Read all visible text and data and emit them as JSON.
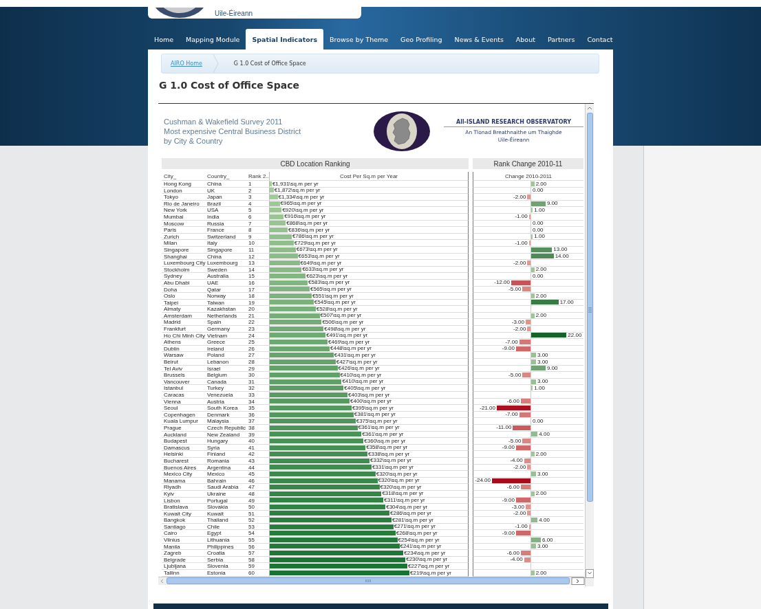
{
  "site": {
    "logo_text": "Uile-Éireann"
  },
  "nav": [
    {
      "label": "Home",
      "selected": false
    },
    {
      "label": "Mapping Module",
      "selected": false
    },
    {
      "label": "Spatial Indicators",
      "selected": true
    },
    {
      "label": "Browse by Theme",
      "selected": false
    },
    {
      "label": "Geo Profiling",
      "selected": false
    },
    {
      "label": "News & Events",
      "selected": false
    },
    {
      "label": "About",
      "selected": false
    },
    {
      "label": "Partners",
      "selected": false
    },
    {
      "label": "Contact",
      "selected": false
    }
  ],
  "breadcrumb": [
    {
      "label": "AIRO Home",
      "kind": "link"
    },
    {
      "label": "G 1.0 Cost of Office Space",
      "kind": "current"
    }
  ],
  "page_title": "G 1.0 Cost of Office Space",
  "report": {
    "title_lines": [
      "Cushman & Wakefield Survey 2011",
      "Most expensive Central Business District",
      "by City & Country"
    ],
    "logo_lines": [
      "All-ISLAND RESEARCH OBSERVATORY",
      "An Tlonad Breathnaithe um Thaighde",
      "Uile-Éireann"
    ],
    "panel_titles": [
      "CBD Location Ranking",
      "Rank Change 2010-11"
    ],
    "columns": [
      "City_",
      "Country_",
      "Rank 2..",
      "Cost Per Sq.m per Year",
      "Change 2010-2011"
    ],
    "rows": [
      {
        "city": "Hong Kong",
        "country": "China",
        "rank": "1",
        "cost": "€1,931\\sq.m per yr",
        "level": 0.01,
        "change": {
          "text": "2.00",
          "kind": "up"
        }
      },
      {
        "city": "London",
        "country": "UK",
        "rank": "2",
        "cost": "€1,872\\sq.m per yr",
        "level": 0.02,
        "change": {
          "text": "0.00",
          "kind": "none"
        }
      },
      {
        "city": "Tokyo",
        "country": "Japan",
        "rank": "3",
        "cost": "€1,334\\sq.m per yr",
        "level": 0.04,
        "change": {
          "text": "-2.00",
          "kind": "down"
        }
      },
      {
        "city": "Rio de Janeiro",
        "country": "Brazil",
        "rank": "4",
        "cost": "€965\\sq.m per yr",
        "level": 0.05,
        "change": {
          "text": "9.00",
          "kind": "up"
        }
      },
      {
        "city": "New York",
        "country": "USA",
        "rank": "5",
        "cost": "€920\\sq.m per yr",
        "level": 0.06,
        "change": {
          "text": "1.00",
          "kind": "up"
        }
      },
      {
        "city": "Mumbai",
        "country": "India",
        "rank": "6",
        "cost": "€916\\sq.m per yr",
        "level": 0.07,
        "change": {
          "text": "-1.00",
          "kind": "down"
        }
      },
      {
        "city": "Moscow",
        "country": "Russia",
        "rank": "7",
        "cost": "€868\\sq.m per yr",
        "level": 0.08,
        "change": {
          "text": "0.00",
          "kind": "none"
        }
      },
      {
        "city": "Paris",
        "country": "France",
        "rank": "8",
        "cost": "€836\\sq.m per yr",
        "level": 0.09,
        "change": {
          "text": "0.00",
          "kind": "none"
        }
      },
      {
        "city": "Zurich",
        "country": "Switzerland",
        "rank": "9",
        "cost": "€786\\sq.m per yr",
        "level": 0.11,
        "change": {
          "text": "1.00",
          "kind": "up"
        }
      },
      {
        "city": "Milan",
        "country": "Italy",
        "rank": "10",
        "cost": "€729\\sq.m per yr",
        "level": 0.12,
        "change": {
          "text": "-1.00",
          "kind": "down"
        }
      },
      {
        "city": "Singapore",
        "country": "Singapore",
        "rank": "11",
        "cost": "€673\\sq.m per yr",
        "level": 0.13,
        "change": {
          "text": "13.00",
          "kind": "up"
        }
      },
      {
        "city": "Shanghai",
        "country": "China",
        "rank": "12",
        "cost": "€653\\sq.m per yr",
        "level": 0.14,
        "change": {
          "text": "14.00",
          "kind": "up"
        }
      },
      {
        "city": "Luxembourg City",
        "country": "Luxembourg",
        "rank": "13",
        "cost": "€649\\sq.m per yr",
        "level": 0.15,
        "change": {
          "text": "-2.00",
          "kind": "down"
        }
      },
      {
        "city": "Stockholm",
        "country": "Sweden",
        "rank": "14",
        "cost": "€633\\sq.m per yr",
        "level": 0.16,
        "change": {
          "text": "2.00",
          "kind": "up"
        }
      },
      {
        "city": "Sydney",
        "country": "Australia",
        "rank": "15",
        "cost": "€623\\sq.m per yr",
        "level": 0.18,
        "change": {
          "text": "0.00",
          "kind": "none"
        }
      },
      {
        "city": "Abu Dhabi",
        "country": "UAE",
        "rank": "16",
        "cost": "€583\\sq.m per yr",
        "level": 0.19,
        "change": {
          "text": "-12.00",
          "kind": "down"
        }
      },
      {
        "city": "Doha",
        "country": "Qatar",
        "rank": "17",
        "cost": "€565\\sq.m per yr",
        "level": 0.2,
        "change": {
          "text": "-5.00",
          "kind": "down"
        }
      },
      {
        "city": "Oslo",
        "country": "Norway",
        "rank": "18",
        "cost": "€551\\sq.m per yr",
        "level": 0.21,
        "change": {
          "text": "2.00",
          "kind": "up"
        }
      },
      {
        "city": "Taipei",
        "country": "Taiwan",
        "rank": "19",
        "cost": "€545\\sq.m per yr",
        "level": 0.22,
        "change": {
          "text": "17.00",
          "kind": "up"
        }
      },
      {
        "city": "Almaty",
        "country": "Kazakhstan",
        "rank": "20",
        "cost": "€528\\sq.m per yr",
        "level": 0.23
      },
      {
        "city": "Amsterdam",
        "country": "Netherlands",
        "rank": "21",
        "cost": "€507\\sq.m per yr",
        "level": 0.25,
        "change": {
          "text": "2.00",
          "kind": "up"
        }
      },
      {
        "city": "Madrid",
        "country": "Spain",
        "rank": "22",
        "cost": "€506\\sq.m per yr",
        "level": 0.26,
        "change": {
          "text": "-3.00",
          "kind": "down"
        }
      },
      {
        "city": "Frankfurt",
        "country": "Germany",
        "rank": "23",
        "cost": "€498\\sq.m per yr",
        "level": 0.27,
        "change": {
          "text": "-2.00",
          "kind": "down"
        }
      },
      {
        "city": "Ho Chi Minh City",
        "country": "Vietnam",
        "rank": "24",
        "cost": "€491\\sq.m per yr",
        "level": 0.28,
        "change": {
          "text": "22.00",
          "kind": "up"
        }
      },
      {
        "city": "Athens",
        "country": "Greece",
        "rank": "25",
        "cost": "€469\\sq.m per yr",
        "level": 0.29,
        "change": {
          "text": "-7.00",
          "kind": "down"
        }
      },
      {
        "city": "Dublin",
        "country": "Ireland",
        "rank": "26",
        "cost": "€448\\sq.m per yr",
        "level": 0.3,
        "change": {
          "text": "-9.00",
          "kind": "down"
        }
      },
      {
        "city": "Warsaw",
        "country": "Poland",
        "rank": "27",
        "cost": "€431\\sq.m per yr",
        "level": 0.32,
        "change": {
          "text": "3.00",
          "kind": "up"
        }
      },
      {
        "city": "Beirut",
        "country": "Lebanon",
        "rank": "28",
        "cost": "€427\\sq.m per yr",
        "level": 0.33,
        "change": {
          "text": "3.00",
          "kind": "up"
        }
      },
      {
        "city": "Tel Aviv",
        "country": "Israel",
        "rank": "29",
        "cost": "€426\\sq.m per yr",
        "level": 0.34,
        "change": {
          "text": "9.00",
          "kind": "up"
        }
      },
      {
        "city": "Brussels",
        "country": "Belgium",
        "rank": "30",
        "cost": "€410\\sq.m per yr",
        "level": 0.35,
        "change": {
          "text": "-5.00",
          "kind": "down"
        }
      },
      {
        "city": "Vancouver",
        "country": "Canada",
        "rank": "31",
        "cost": "€410\\sq.m per yr",
        "level": 0.36,
        "change": {
          "text": "3.00",
          "kind": "up"
        }
      },
      {
        "city": "Istanbul",
        "country": "Turkey",
        "rank": "32",
        "cost": "€405\\sq.m per yr",
        "level": 0.37,
        "change": {
          "text": "1.00",
          "kind": "up"
        }
      },
      {
        "city": "Caracas",
        "country": "Venezuela",
        "rank": "33",
        "cost": "€403\\sq.m per yr",
        "level": 0.39
      },
      {
        "city": "Vienna",
        "country": "Austria",
        "rank": "34",
        "cost": "€400\\sq.m per yr",
        "level": 0.4,
        "change": {
          "text": "-6.00",
          "kind": "down"
        }
      },
      {
        "city": "Seoul",
        "country": "South Korea",
        "rank": "35",
        "cost": "€395\\sq.m per yr",
        "level": 0.41,
        "change": {
          "text": "-21.00",
          "kind": "down"
        }
      },
      {
        "city": "Copenhagen",
        "country": "Denmark",
        "rank": "36",
        "cost": "€381\\sq.m per yr",
        "level": 0.42,
        "change": {
          "text": "-7.00",
          "kind": "down"
        }
      },
      {
        "city": "Kuala Lumpur",
        "country": "Malaysia",
        "rank": "37",
        "cost": "€375\\sq.m per yr",
        "level": 0.43,
        "change": {
          "text": "0.00",
          "kind": "none"
        }
      },
      {
        "city": "Prague",
        "country": "Czech Republic",
        "rank": "38",
        "cost": "€361\\sq.m per yr",
        "level": 0.44,
        "change": {
          "text": "-11.00",
          "kind": "down"
        }
      },
      {
        "city": "Auckland",
        "country": "New Zealand",
        "rank": "39",
        "cost": "€361\\sq.m per yr",
        "level": 0.46,
        "change": {
          "text": "4.00",
          "kind": "up"
        }
      },
      {
        "city": "Budapest",
        "country": "Hungary",
        "rank": "40",
        "cost": "€360\\sq.m per yr",
        "level": 0.47,
        "change": {
          "text": "-5.00",
          "kind": "down"
        }
      },
      {
        "city": "Damascus",
        "country": "Syria",
        "rank": "41",
        "cost": "€358\\sq.m per yr",
        "level": 0.48,
        "change": {
          "text": "-9.00",
          "kind": "down"
        }
      },
      {
        "city": "Helsinki",
        "country": "Finland",
        "rank": "42",
        "cost": "€338\\sq.m per yr",
        "level": 0.49,
        "change": {
          "text": "2.00",
          "kind": "up"
        }
      },
      {
        "city": "Bucharest",
        "country": "Romania",
        "rank": "43",
        "cost": "€332\\sq.m per yr",
        "level": 0.5,
        "change": {
          "text": "-4.00",
          "kind": "down"
        }
      },
      {
        "city": "Buenos Aires",
        "country": "Argentina",
        "rank": "44",
        "cost": "€331\\sq.m per yr",
        "level": 0.51,
        "change": {
          "text": "-2.00",
          "kind": "down"
        }
      },
      {
        "city": "Mexico City",
        "country": "Mexico",
        "rank": "45",
        "cost": "€320\\sq.m per yr",
        "level": 0.53,
        "change": {
          "text": "3.00",
          "kind": "up"
        }
      },
      {
        "city": "Manama",
        "country": "Bahrain",
        "rank": "46",
        "cost": "€320\\sq.m per yr",
        "level": 0.54,
        "change": {
          "text": "-24.00",
          "kind": "down"
        }
      },
      {
        "city": "Riyadh",
        "country": "Saudi Arabia",
        "rank": "47",
        "cost": "€320\\sq.m per yr",
        "level": 0.55,
        "change": {
          "text": "-6.00",
          "kind": "down"
        }
      },
      {
        "city": "Kyiv",
        "country": "Ukraine",
        "rank": "48",
        "cost": "€318\\sq.m per yr",
        "level": 0.56,
        "change": {
          "text": "2.00",
          "kind": "up"
        }
      },
      {
        "city": "Lisbon",
        "country": "Portugal",
        "rank": "49",
        "cost": "€311\\sq.m per yr",
        "level": 0.57,
        "change": {
          "text": "-9.00",
          "kind": "down"
        }
      },
      {
        "city": "Bratislava",
        "country": "Slovakia",
        "rank": "50",
        "cost": "€304\\sq.m per yr",
        "level": 0.58,
        "change": {
          "text": "-3.00",
          "kind": "down"
        }
      },
      {
        "city": "Kuwait City",
        "country": "Kuwait",
        "rank": "51",
        "cost": "€286\\sq.m per yr",
        "level": 0.6,
        "change": {
          "text": "-2.00",
          "kind": "down"
        }
      },
      {
        "city": "Bangkok",
        "country": "Thailand",
        "rank": "52",
        "cost": "€281\\sq.m per yr",
        "level": 0.61,
        "change": {
          "text": "4.00",
          "kind": "up"
        }
      },
      {
        "city": "Santiago",
        "country": "Chile",
        "rank": "53",
        "cost": "€271\\sq.m per yr",
        "level": 0.62,
        "change": {
          "text": "-1.00",
          "kind": "down"
        }
      },
      {
        "city": "Cairo",
        "country": "Egypt",
        "rank": "54",
        "cost": "€268\\sq.m per yr",
        "level": 0.63,
        "change": {
          "text": "-9.00",
          "kind": "down"
        }
      },
      {
        "city": "Vilnius",
        "country": "Lithuania",
        "rank": "55",
        "cost": "€254\\sq.m per yr",
        "level": 0.64,
        "change": {
          "text": "6.00",
          "kind": "up"
        }
      },
      {
        "city": "Manila",
        "country": "Philippines",
        "rank": "56",
        "cost": "€241\\sq.m per yr",
        "level": 0.65,
        "change": {
          "text": "3.00",
          "kind": "up"
        }
      },
      {
        "city": "Zagreb",
        "country": "Croatia",
        "rank": "57",
        "cost": "€234\\sq.m per yr",
        "level": 0.67,
        "change": {
          "text": "-6.00",
          "kind": "down"
        }
      },
      {
        "city": "Belgrade",
        "country": "Serbia",
        "rank": "58",
        "cost": "€230\\sq.m per yr",
        "level": 0.68,
        "change": {
          "text": "-4.00",
          "kind": "down"
        }
      },
      {
        "city": "Ljubljana",
        "country": "Slovenia",
        "rank": "59",
        "cost": "€227\\sq.m per yr",
        "level": 0.69
      },
      {
        "city": "Tallinn",
        "country": "Estonia",
        "rank": "60",
        "cost": "€219\\sq.m per yr",
        "level": 0.7,
        "change": {
          "text": "2.00",
          "kind": "up"
        }
      }
    ]
  }
}
